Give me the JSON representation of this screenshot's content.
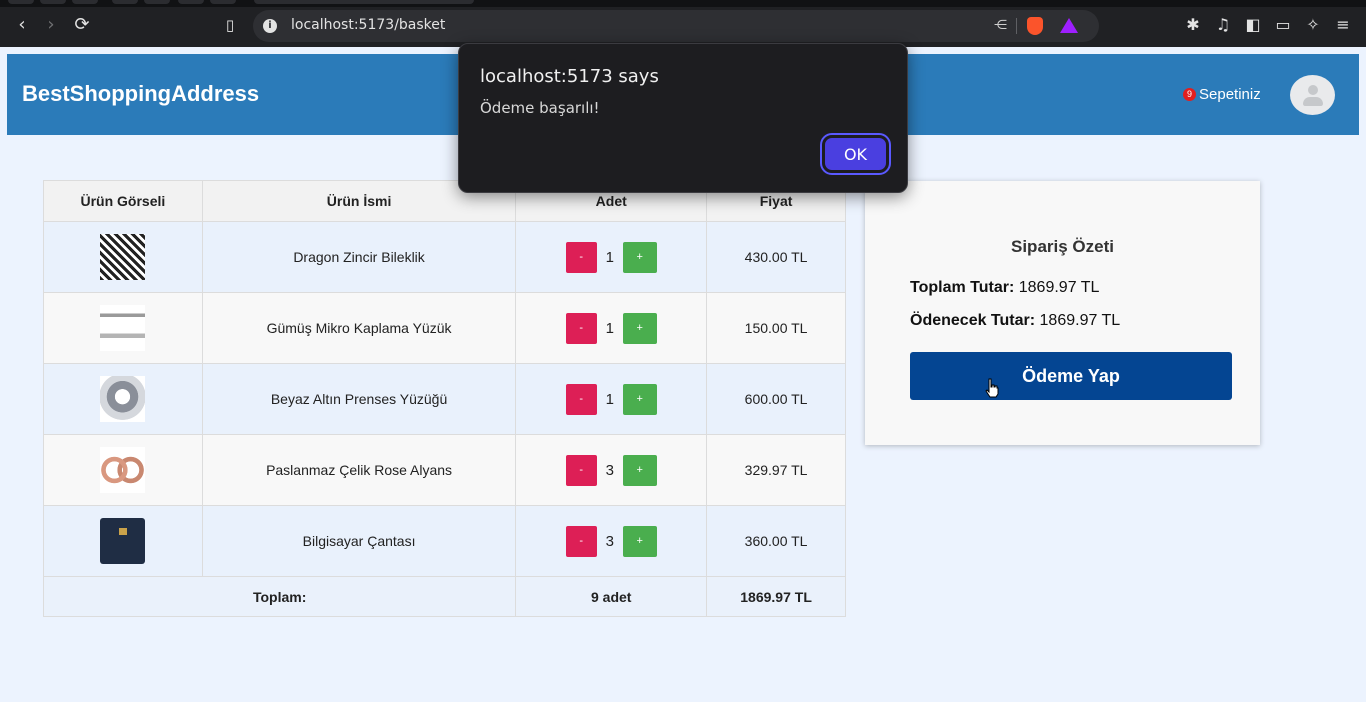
{
  "browser": {
    "url": "localhost:5173/basket"
  },
  "header": {
    "brand": "BestShoppingAddress",
    "cart_count": "9",
    "cart_label": "Sepetiniz"
  },
  "table": {
    "headers": [
      "Ürün Görseli",
      "Ürün İsmi",
      "Adet",
      "Fiyat"
    ],
    "rows": [
      {
        "name": "Dragon Zincir Bileklik",
        "qty": "1",
        "price": "430.00 TL"
      },
      {
        "name": "Gümüş Mikro Kaplama Yüzük",
        "qty": "1",
        "price": "150.00 TL"
      },
      {
        "name": "Beyaz Altın Prenses Yüzüğü",
        "qty": "1",
        "price": "600.00 TL"
      },
      {
        "name": "Paslanmaz Çelik Rose Alyans",
        "qty": "3",
        "price": "329.97 TL"
      },
      {
        "name": "Bilgisayar Çantası",
        "qty": "3",
        "price": "360.00 TL"
      }
    ],
    "minus_label": "-",
    "plus_label": "+",
    "total_label": "Toplam:",
    "total_qty": "9 adet",
    "total_price": "1869.97 TL"
  },
  "summary": {
    "title": "Sipariş Özeti",
    "total_label": "Toplam Tutar:",
    "total_value": "1869.97 TL",
    "payable_label": "Ödenecek Tutar:",
    "payable_value": "1869.97 TL",
    "pay_button": "Ödeme Yap"
  },
  "dialog": {
    "title": "localhost:5173 says",
    "message": "Ödeme başarılı!",
    "ok_label": "OK"
  }
}
